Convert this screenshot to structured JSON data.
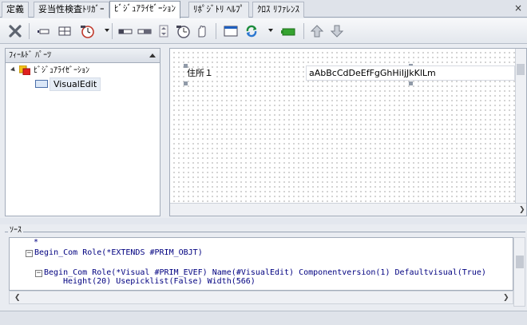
{
  "tabs": [
    {
      "label": "定義",
      "active": false
    },
    {
      "label": "妥当性検査ﾄﾘｶﾞｰ",
      "active": false
    },
    {
      "label": "ﾋﾞｼﾞｭｱﾗｲｾﾞｰｼｮﾝ",
      "active": true
    },
    {
      "label": "ﾘﾎﾟｼﾞﾄﾘ ﾍﾙﾌﾟ",
      "active": false
    },
    {
      "label": "ｸﾛｽ ﾘﾌｧﾚﾝｽ",
      "active": false
    }
  ],
  "tab_close_glyph": "×",
  "toolbar": {
    "icons": [
      "delete-icon",
      "field-single-icon",
      "field-grid-icon",
      "timer-icon",
      "field-bar-icon",
      "field-bar2-icon",
      "spinner-icon",
      "clock-icon",
      "hand-icon",
      "window-icon",
      "refresh-icon",
      "green-box-icon",
      "arrow-up-icon",
      "arrow-down-icon"
    ]
  },
  "left_panel": {
    "title": "ﾌｨｰﾙﾄﾞ ﾊﾟｰﾂ",
    "tree": {
      "parent_label": "ﾋﾞｼﾞｭｱﾗｲｾﾞｰｼｮﾝ",
      "child_label": "VisualEdit"
    }
  },
  "canvas": {
    "field_label": "住所１",
    "field_value": "aAbBcCdDeEfFgGhHiIjJkKlLm"
  },
  "source": {
    "title": "ｿｰｽ",
    "lines": [
      "*",
      "Begin_Com Role(*EXTENDS #PRIM_OBJT)",
      "Begin_Com Role(*Visual #PRIM_EVEF) Name(#VisualEdit) Componentversion(1) Defaultvisual(True)",
      "Height(20) Usepicklist(False) Width(566)"
    ]
  },
  "colors": {
    "accent": "#1f5fbf",
    "code_text": "#000080"
  }
}
